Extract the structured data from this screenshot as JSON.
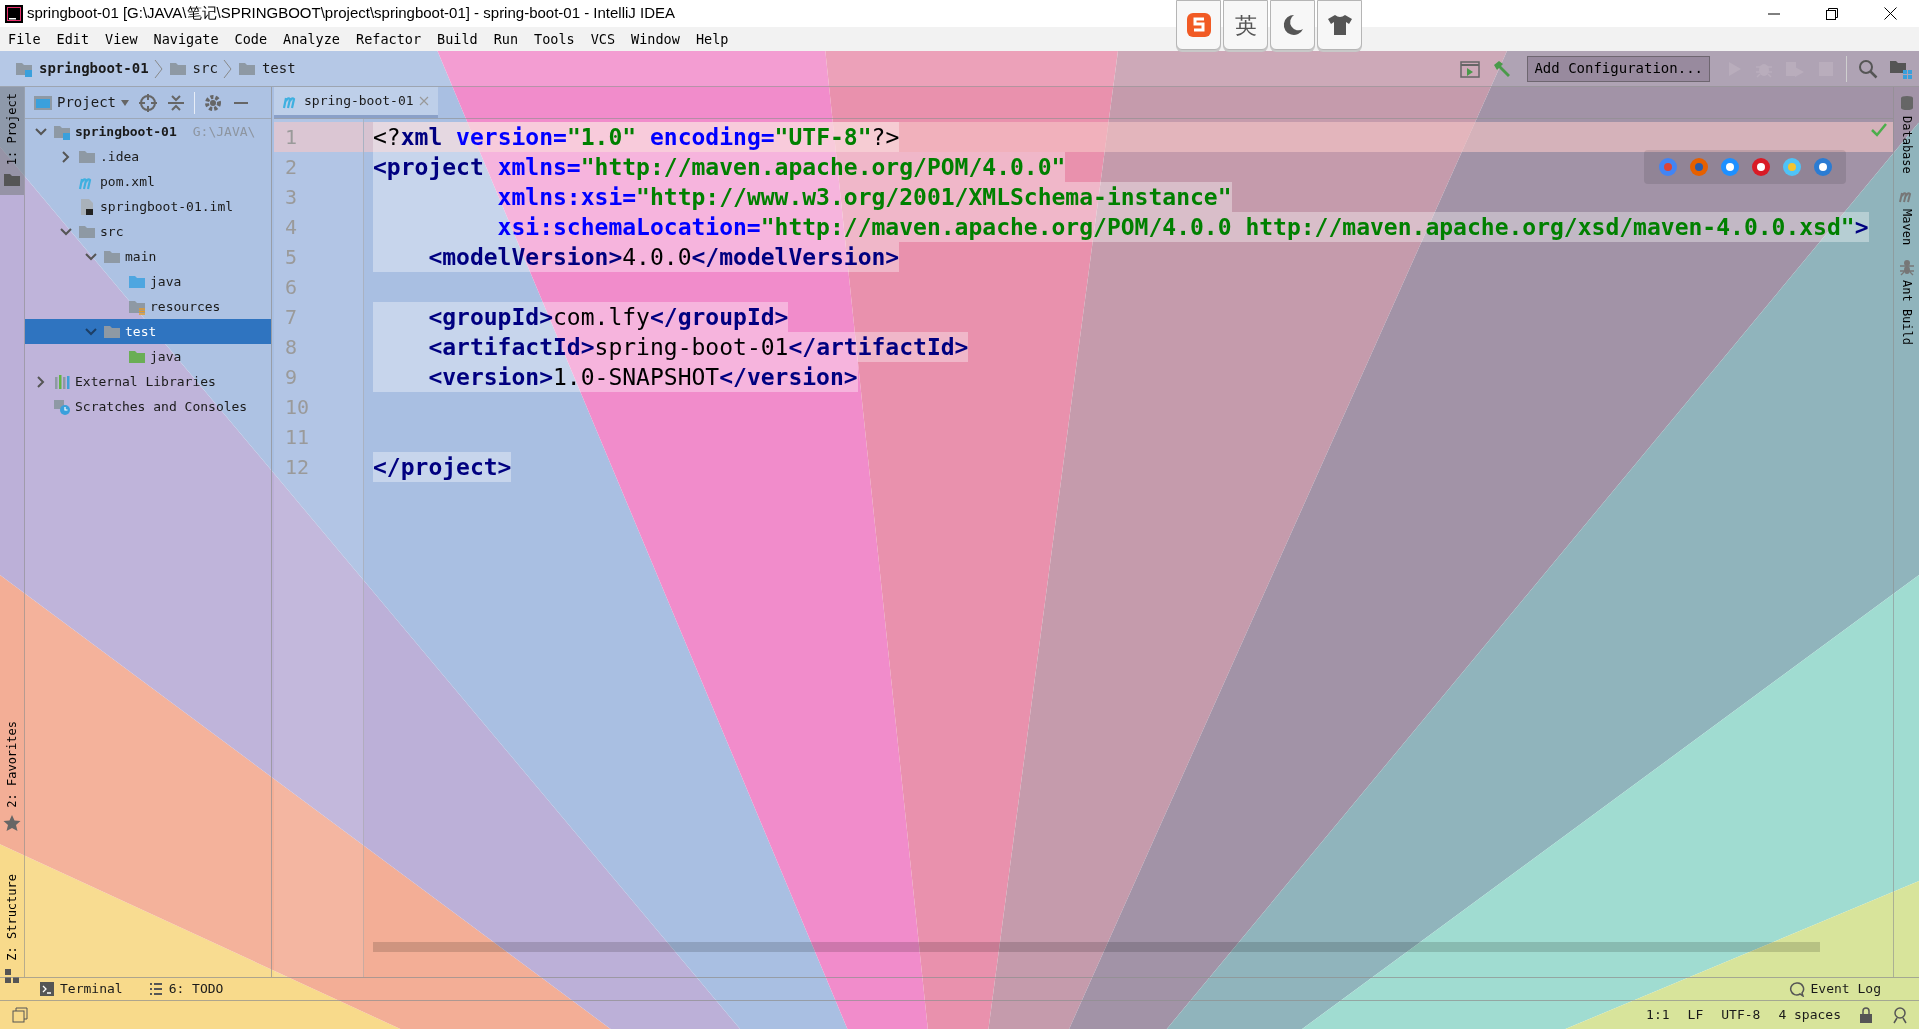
{
  "window": {
    "title": "springboot-01 [G:\\JAVA\\笔记\\SPRINGBOOT\\project\\springboot-01] - spring-boot-01 - IntelliJ IDEA"
  },
  "ime_toolbar": {
    "language": "英"
  },
  "menu": [
    "File",
    "Edit",
    "View",
    "Navigate",
    "Code",
    "Analyze",
    "Refactor",
    "Build",
    "Run",
    "Tools",
    "VCS",
    "Window",
    "Help"
  ],
  "breadcrumbs": [
    {
      "label": "springboot-01",
      "kind": "module"
    },
    {
      "label": "src",
      "kind": "folder"
    },
    {
      "label": "test",
      "kind": "folder"
    }
  ],
  "toolbar": {
    "run_configuration": "Add Configuration..."
  },
  "left_stripe": [
    {
      "label": "1: Project",
      "selected": true
    },
    {
      "label": "2: Favorites",
      "selected": false
    },
    {
      "label": "Z: Structure",
      "selected": false
    }
  ],
  "project_panel": {
    "title": "Project",
    "tree": [
      {
        "label": "springboot-01",
        "hint": "G:\\JAVA\\",
        "kind": "module",
        "expanded": true,
        "selected": false,
        "children": [
          {
            "label": ".idea",
            "kind": "folder",
            "expanded": false,
            "selected": false
          },
          {
            "label": "pom.xml",
            "kind": "maven",
            "selected": false
          },
          {
            "label": "springboot-01.iml",
            "kind": "iml",
            "selected": false
          },
          {
            "label": "src",
            "kind": "folder",
            "expanded": true,
            "selected": false,
            "children": [
              {
                "label": "main",
                "kind": "folder",
                "expanded": true,
                "selected": false,
                "children": [
                  {
                    "label": "java",
                    "kind": "source",
                    "selected": false
                  },
                  {
                    "label": "resources",
                    "kind": "resources",
                    "selected": false
                  }
                ]
              },
              {
                "label": "test",
                "kind": "folder",
                "expanded": true,
                "selected": true,
                "children": [
                  {
                    "label": "java",
                    "kind": "test-source",
                    "selected": false
                  }
                ]
              }
            ]
          }
        ]
      },
      {
        "label": "External Libraries",
        "kind": "libraries",
        "expanded": false,
        "selected": false
      },
      {
        "label": "Scratches and Consoles",
        "kind": "scratches",
        "selected": false
      }
    ]
  },
  "editor": {
    "tabs": [
      {
        "label": "spring-boot-01",
        "selected": true
      }
    ],
    "lines": [
      {
        "number": "1",
        "current": true,
        "tokens": [
          {
            "kind": "punct",
            "text": "<?"
          },
          {
            "kind": "tag",
            "text": "xml"
          },
          {
            "kind": "attr",
            "text": " version="
          },
          {
            "kind": "value",
            "text": "\"1.0\""
          },
          {
            "kind": "attr",
            "text": " encoding="
          },
          {
            "kind": "value",
            "text": "\"UTF-8\""
          },
          {
            "kind": "punct",
            "text": "?>"
          }
        ]
      },
      {
        "number": "2",
        "current": false,
        "tokens": [
          {
            "kind": "tag",
            "text": "<project"
          },
          {
            "kind": "attr",
            "text": " xmlns="
          },
          {
            "kind": "value",
            "text": "\"http://maven.apache.org/POM/4.0.0\""
          }
        ]
      },
      {
        "number": "3",
        "current": false,
        "tokens": [
          {
            "kind": "attr",
            "text": "         xmlns:xsi="
          },
          {
            "kind": "value",
            "text": "\"http://www.w3.org/2001/XMLSchema-instance\""
          }
        ]
      },
      {
        "number": "4",
        "current": false,
        "tokens": [
          {
            "kind": "attr",
            "text": "         xsi:schemaLocation="
          },
          {
            "kind": "value",
            "text": "\"http://maven.apache.org/POM/4.0.0 http://maven.apache.org/xsd/maven-4.0.0.xsd\""
          },
          {
            "kind": "tag",
            "text": ">"
          }
        ]
      },
      {
        "number": "5",
        "current": false,
        "tokens": [
          {
            "kind": "tag",
            "text": "    <modelVersion>"
          },
          {
            "kind": "text",
            "text": "4.0.0"
          },
          {
            "kind": "tag",
            "text": "</modelVersion>"
          }
        ]
      },
      {
        "number": "6",
        "current": false
      },
      {
        "number": "7",
        "current": false,
        "tokens": [
          {
            "kind": "tag",
            "text": "    <groupId>"
          },
          {
            "kind": "text",
            "text": "com.lfy"
          },
          {
            "kind": "tag",
            "text": "</groupId>"
          }
        ]
      },
      {
        "number": "8",
        "current": false,
        "tokens": [
          {
            "kind": "tag",
            "text": "    <artifactId>"
          },
          {
            "kind": "text",
            "text": "spring-boot-01"
          },
          {
            "kind": "tag",
            "text": "</artifactId>"
          }
        ]
      },
      {
        "number": "9",
        "current": false,
        "tokens": [
          {
            "kind": "tag",
            "text": "    <version>"
          },
          {
            "kind": "text",
            "text": "1.0-SNAPSHOT"
          },
          {
            "kind": "tag",
            "text": "</version>"
          }
        ]
      },
      {
        "number": "10",
        "current": false
      },
      {
        "number": "11",
        "current": false
      },
      {
        "number": "12",
        "current": false,
        "tokens": [
          {
            "kind": "tag",
            "text": "</project>"
          }
        ]
      }
    ]
  },
  "right_stripe": [
    "Database",
    "Maven",
    "Ant Build"
  ],
  "bottom_tools": [
    {
      "kind": "terminal",
      "label": "Terminal"
    },
    {
      "kind": "todo",
      "label": "6: TODO"
    }
  ],
  "event_log": "Event Log",
  "status_bar": [
    "1:1",
    "LF",
    "UTF-8",
    "4 spaces"
  ]
}
